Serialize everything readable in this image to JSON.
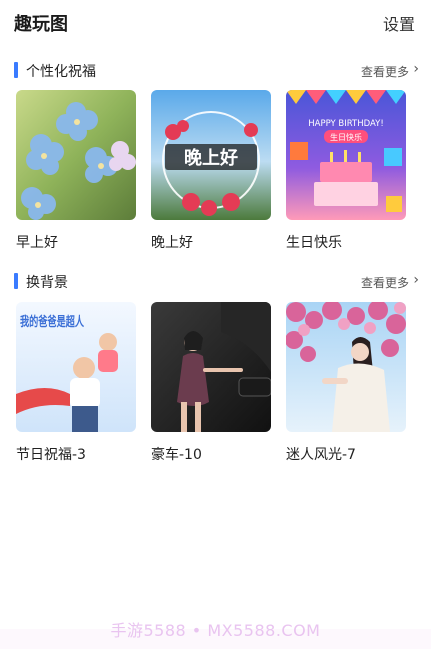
{
  "header": {
    "title": "趣玩图",
    "settings_label": "设置"
  },
  "sections": [
    {
      "title": "个性化祝福",
      "more_label": "查看更多",
      "items": [
        {
          "label": "早上好",
          "thumb": "blue-flowers"
        },
        {
          "label": "晚上好",
          "thumb": "red-flowers-sky",
          "overlay_text": "晚上好"
        },
        {
          "label": "生日快乐",
          "thumb": "birthday-cake",
          "overlay_title": "HAPPY BIRTHDAY!",
          "overlay_badge": "生日快乐"
        }
      ]
    },
    {
      "title": "换背景",
      "more_label": "查看更多",
      "items": [
        {
          "label": "节日祝福-3",
          "thumb": "father-child",
          "overlay_text": "我的爸爸是超人"
        },
        {
          "label": "豪车-10",
          "thumb": "woman-car"
        },
        {
          "label": "迷人风光-7",
          "thumb": "woman-blossoms"
        }
      ]
    }
  ],
  "watermark": "手游5588 • MX5588.COM",
  "colors": {
    "accent": "#3a7bff",
    "watermark": "#e9c4f0"
  }
}
